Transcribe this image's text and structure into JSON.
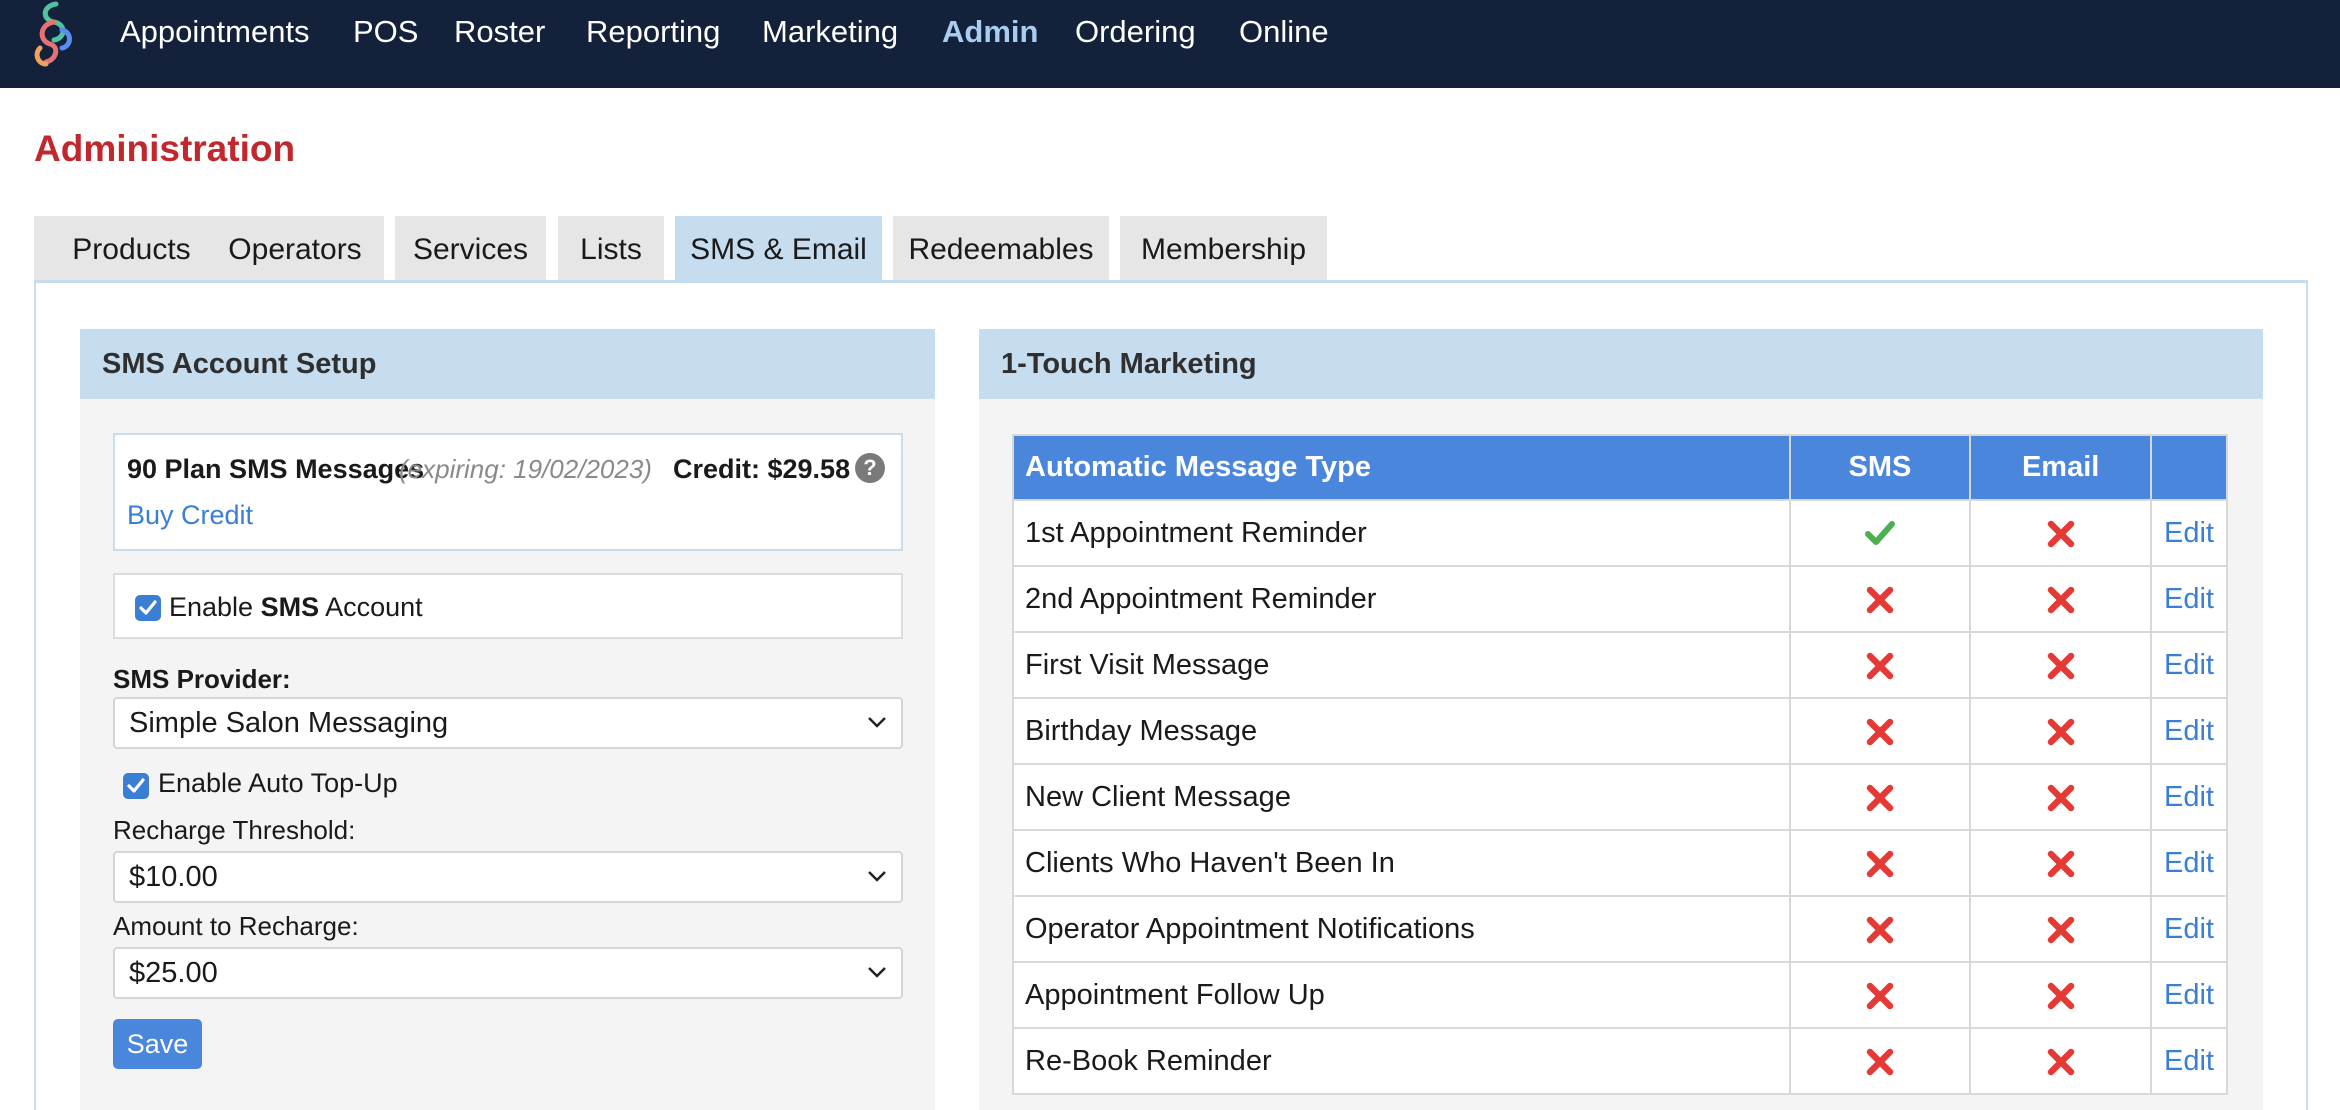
{
  "nav": {
    "items": [
      {
        "label": "Appointments"
      },
      {
        "label": "POS"
      },
      {
        "label": "Roster"
      },
      {
        "label": "Reporting"
      },
      {
        "label": "Marketing"
      },
      {
        "label": "Admin",
        "active": true
      },
      {
        "label": "Ordering"
      },
      {
        "label": "Online"
      }
    ]
  },
  "page": {
    "title": "Administration"
  },
  "tabs": [
    {
      "label": "Products"
    },
    {
      "label": "Operators"
    },
    {
      "label": "Services"
    },
    {
      "label": "Lists"
    },
    {
      "label": "SMS & Email",
      "active": true
    },
    {
      "label": "Redeemables"
    },
    {
      "label": "Membership"
    }
  ],
  "sms_setup": {
    "header": "SMS Account Setup",
    "plan_name": "90 Plan SMS Messages",
    "plan_expiry": "(expiring: 19/02/2023)",
    "credit_label": "Credit: $29.58",
    "help_symbol": "?",
    "buy_credit": "Buy Credit",
    "enable_prefix": "Enable ",
    "enable_bold": "SMS",
    "enable_suffix": " Account",
    "enable_checked": true,
    "provider_label": "SMS Provider:",
    "provider_value": "Simple Salon Messaging",
    "auto_topup_label": "Enable Auto Top-Up",
    "auto_topup_checked": true,
    "threshold_label": "Recharge Threshold:",
    "threshold_value": "$10.00",
    "recharge_label": "Amount to Recharge:",
    "recharge_value": "$25.00",
    "save_label": "Save"
  },
  "marketing": {
    "header": "1-Touch Marketing",
    "columns": {
      "type": "Automatic Message Type",
      "sms": "SMS",
      "email": "Email",
      "action": ""
    },
    "edit_label": "Edit",
    "rows": [
      {
        "name": "1st Appointment Reminder",
        "sms": true,
        "email": false
      },
      {
        "name": "2nd Appointment Reminder",
        "sms": false,
        "email": false
      },
      {
        "name": "First Visit Message",
        "sms": false,
        "email": false
      },
      {
        "name": "Birthday Message",
        "sms": false,
        "email": false
      },
      {
        "name": "New Client Message",
        "sms": false,
        "email": false
      },
      {
        "name": "Clients Who Haven't Been In",
        "sms": false,
        "email": false
      },
      {
        "name": "Operator Appointment Notifications",
        "sms": false,
        "email": false
      },
      {
        "name": "Appointment Follow Up",
        "sms": false,
        "email": false
      },
      {
        "name": "Re-Book Reminder",
        "sms": false,
        "email": false
      }
    ]
  },
  "colors": {
    "nav_bg": "#14213a",
    "title_red": "#c0282d",
    "accent_blue": "#4a86dc",
    "tab_active": "#c6dcef",
    "check_green": "#4caf50",
    "cross_red": "#e53935"
  }
}
